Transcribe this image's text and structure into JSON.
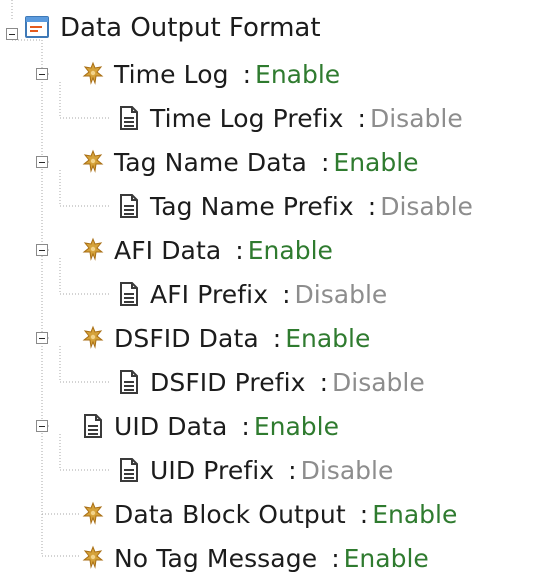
{
  "tree": {
    "root": {
      "label": "Data Output Format",
      "icon": "form-window-icon"
    },
    "items": [
      {
        "label": "Time Log",
        "separator": ":",
        "value": "Enable",
        "icon": "gear-icon",
        "child": {
          "label": "Time Log Prefix",
          "separator": ":",
          "value": "Disable",
          "icon": "document-icon"
        }
      },
      {
        "label": "Tag Name Data",
        "separator": ":",
        "value": "Enable",
        "icon": "gear-icon",
        "child": {
          "label": "Tag Name Prefix",
          "separator": ":",
          "value": "Disable",
          "icon": "document-icon"
        }
      },
      {
        "label": "AFI Data",
        "separator": ":",
        "value": "Enable",
        "icon": "gear-icon",
        "child": {
          "label": "AFI Prefix",
          "separator": ":",
          "value": "Disable",
          "icon": "document-icon"
        }
      },
      {
        "label": "DSFID Data",
        "separator": ":",
        "value": "Enable",
        "icon": "gear-icon",
        "child": {
          "label": "DSFID Prefix",
          "separator": ":",
          "value": "Disable",
          "icon": "document-icon"
        }
      },
      {
        "label": "UID Data",
        "separator": ":",
        "value": "Enable",
        "icon": "document-icon",
        "child": {
          "label": "UID Prefix",
          "separator": ":",
          "value": "Disable",
          "icon": "document-icon"
        }
      },
      {
        "label": "Data Block Output",
        "separator": ":",
        "value": "Enable",
        "icon": "gear-icon"
      },
      {
        "label": "No Tag Message",
        "separator": ":",
        "value": "Enable",
        "icon": "gear-icon"
      }
    ]
  },
  "colors": {
    "enable": "#2f7b2f",
    "disable": "#8d8d8d",
    "text": "#1c1c1c",
    "connector": "#9a9a9a"
  }
}
